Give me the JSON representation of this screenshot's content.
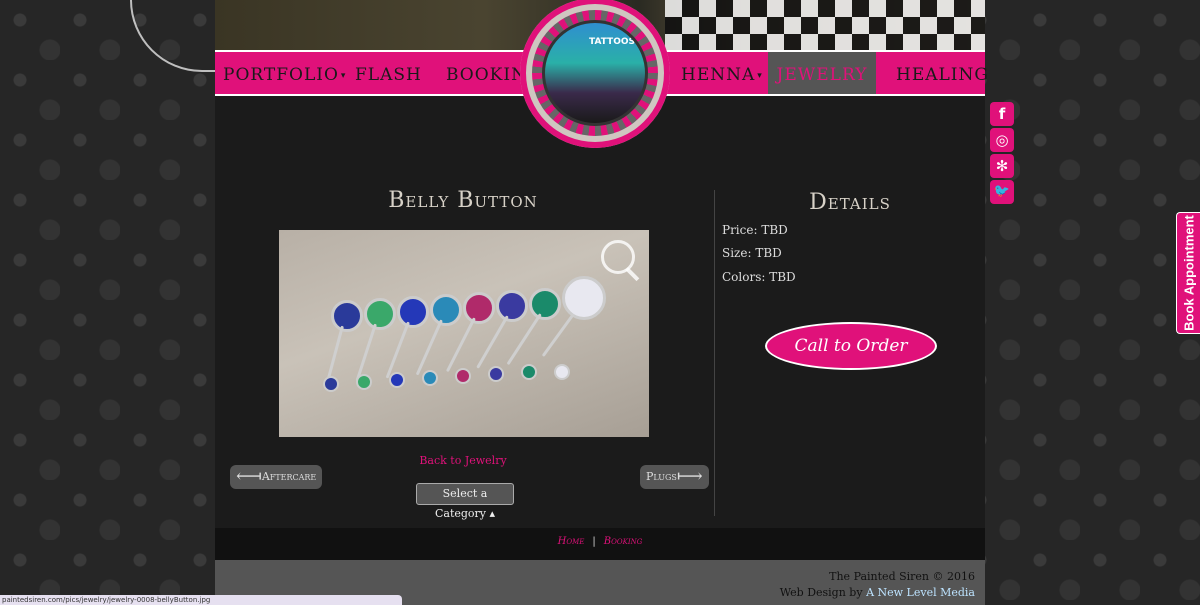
{
  "nav": {
    "items": [
      {
        "label": "Portfolio",
        "caret": "▾"
      },
      {
        "label": "Flash",
        "caret": ""
      },
      {
        "label": "Booking",
        "caret": "▾"
      },
      {
        "label": "Henna",
        "caret": "▾"
      },
      {
        "label": "Jewelry",
        "caret": "",
        "active": true
      },
      {
        "label": "Healing",
        "caret": ""
      }
    ]
  },
  "logo": {
    "sign_text": "TATTOOS"
  },
  "social": [
    {
      "name": "facebook-icon",
      "glyph": "f"
    },
    {
      "name": "instagram-icon",
      "glyph": "◎"
    },
    {
      "name": "yelp-icon",
      "glyph": "✻"
    },
    {
      "name": "twitter-icon",
      "glyph": "🐦"
    }
  ],
  "book_appointment": "Book Appointment",
  "product": {
    "title": "Belly Button",
    "back_link": "Back to Jewelry",
    "prev_label": "Aftercare",
    "prev_arrow": "⟻",
    "next_label": "Plugs",
    "next_arrow": "⟼",
    "category_select": "Select a Category ▴"
  },
  "details": {
    "title": "Details",
    "price": "Price: TBD",
    "size": "Size: TBD",
    "colors": "Colors: TBD",
    "cta": "Call to Order"
  },
  "footer_nav": {
    "home": "Home",
    "sep": "|",
    "booking": "Booking"
  },
  "footer": {
    "copyright": "The Painted Siren © 2016",
    "design_prefix": "Web Design by",
    "design_link": "A New Level Media"
  },
  "status_url": "paintedsiren.com/pics/jewelry/jewelry-0008-bellyButton.jpg",
  "colors": {
    "accent": "#e0117a",
    "panel": "#1b1b1b",
    "active_nav": "#555555"
  }
}
